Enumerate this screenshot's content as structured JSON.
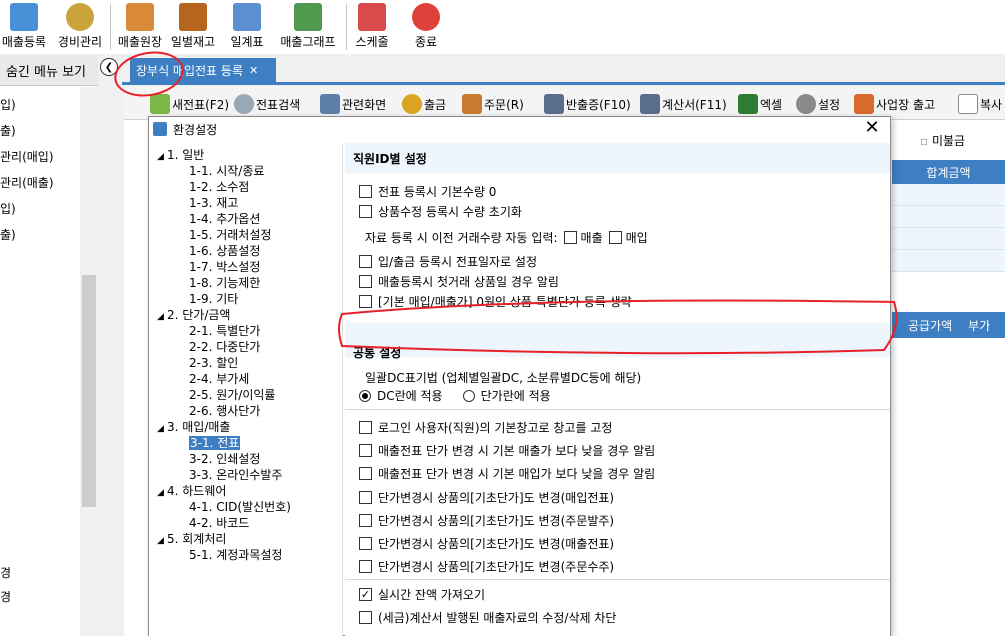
{
  "toolbar": {
    "items": [
      {
        "label": "매출등록",
        "color": "#4a90d9"
      },
      {
        "label": "경비관리",
        "color": "#c9a23a"
      },
      {
        "label": "매출원장",
        "color": "#d98b3a"
      },
      {
        "label": "일별재고",
        "color": "#b5651d"
      },
      {
        "label": "일계표",
        "color": "#5b8fd0"
      },
      {
        "label": "매출그래프",
        "color": "#4f9a4f"
      },
      {
        "label": "스케줄",
        "color": "#d94a4a"
      },
      {
        "label": "종료",
        "color": "#e0403a"
      }
    ]
  },
  "left_menu": {
    "header": "숨긴 메뉴 보기",
    "items": [
      "입)",
      "출)",
      "관리(매입)",
      "관리(매출)",
      "입)",
      "출)",
      "경",
      "경"
    ]
  },
  "doc_tab": {
    "label": "장부식 매입전표 등록"
  },
  "main_toolbar": {
    "items": [
      "새전표(F2)",
      "전표검색",
      "관련화면",
      "출금",
      "주문(R)",
      "반출증(F10)",
      "계산서(F11)",
      "엑셀",
      "설정",
      "사업장 출고",
      "복사"
    ]
  },
  "background": {
    "tab_unpaid": "미불금",
    "grid_header": "합계금액",
    "bottom_headers": [
      "공급가액",
      "부가"
    ]
  },
  "dialog": {
    "title": "환경설정",
    "tree": [
      {
        "label": "1. 일반",
        "level": 0
      },
      {
        "label": "1-1. 시작/종료",
        "level": 1
      },
      {
        "label": "1-2. 소수점",
        "level": 1
      },
      {
        "label": "1-3. 재고",
        "level": 1
      },
      {
        "label": "1-4. 추가옵션",
        "level": 1
      },
      {
        "label": "1-5. 거래처설정",
        "level": 1
      },
      {
        "label": "1-6. 상품설정",
        "level": 1
      },
      {
        "label": "1-7. 박스설정",
        "level": 1
      },
      {
        "label": "1-8. 기능제한",
        "level": 1
      },
      {
        "label": "1-9. 기타",
        "level": 1
      },
      {
        "label": "2. 단가/금액",
        "level": 0
      },
      {
        "label": "2-1. 특별단가",
        "level": 1
      },
      {
        "label": "2-2. 다중단가",
        "level": 1
      },
      {
        "label": "2-3. 할인",
        "level": 1
      },
      {
        "label": "2-4. 부가세",
        "level": 1
      },
      {
        "label": "2-5. 원가/이익률",
        "level": 1
      },
      {
        "label": "2-6. 행사단가",
        "level": 1
      },
      {
        "label": "3. 매입/매출",
        "level": 0
      },
      {
        "label": "3-1. 전표",
        "level": 1,
        "selected": true
      },
      {
        "label": "3-2. 인쇄설정",
        "level": 1
      },
      {
        "label": "3-3. 온라인수발주",
        "level": 1
      },
      {
        "label": "4. 하드웨어",
        "level": 0
      },
      {
        "label": "4-1. CID(발신번호)",
        "level": 1
      },
      {
        "label": "4-2. 바코드",
        "level": 1
      },
      {
        "label": "5. 회계처리",
        "level": 0
      },
      {
        "label": "5-1. 계정과목설정",
        "level": 1
      }
    ],
    "section1": {
      "title": "직원ID별 설정",
      "checks": [
        {
          "label": "전표 등록시 기본수량 0",
          "checked": false
        },
        {
          "label": "상품수정 등록시 수량 초기화",
          "checked": false
        }
      ],
      "auto_input": {
        "label": "자료 등록 시 이전 거래수량 자동 입력:",
        "opt1": "매출",
        "opt2": "매입"
      },
      "checks2": [
        {
          "label": "입/출금 등록시 전표일자로 설정",
          "checked": false
        },
        {
          "label": "매출등록시 첫거래 상품일 경우 알림",
          "checked": false
        },
        {
          "label": "[기본 매입/매출가] 0원인 상품 특별단가 등록 생략",
          "checked": false
        }
      ]
    },
    "section2": {
      "title": "공통 설정",
      "dc_label": "일괄DC표기법 (업체별일괄DC, 소분류별DC등에 해당)",
      "radio1": "DC란에 적용",
      "radio2": "단가란에 적용",
      "checks": [
        {
          "label": "로그인 사용자(직원)의 기본창고로 창고를 고정",
          "checked": false
        },
        {
          "label": "매출전표 단가 변경 시 기본 매출가 보다 낮을 경우 알림",
          "checked": false
        },
        {
          "label": "매출전표 단가 변경 시 기본 매입가 보다 낮을 경우 알림",
          "checked": false
        },
        {
          "label": "단가변경시 상품의[기초단가]도 변경(매입전표)",
          "checked": false
        },
        {
          "label": "단가변경시 상품의[기초단가]도 변경(주문발주)",
          "checked": false
        },
        {
          "label": "단가변경시 상품의[기초단가]도 변경(매출전표)",
          "checked": false
        },
        {
          "label": "단가변경시 상품의[기초단가]도 변경(주문수주)",
          "checked": false
        }
      ],
      "checks3": [
        {
          "label": "실시간 잔액 가져오기",
          "checked": true
        },
        {
          "label": "(세금)계산서 발행된 매출자료의 수정/삭제 차단",
          "checked": false
        }
      ]
    },
    "checkmark": "✓"
  },
  "colors": {
    "accent": "#3d7fc2",
    "annotation": "#e8202a",
    "band": "#eef5fc"
  }
}
